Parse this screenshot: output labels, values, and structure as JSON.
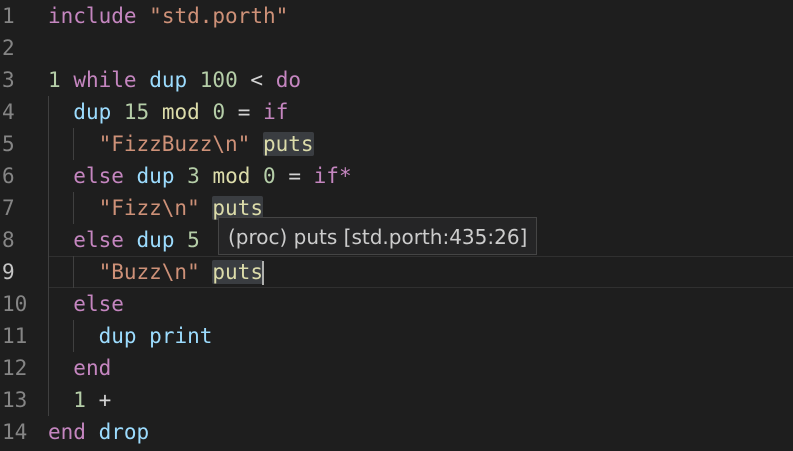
{
  "editor": {
    "lines": [
      {
        "no": "1",
        "tokens": [
          {
            "t": "include",
            "c": "kw"
          },
          {
            "t": " ",
            "c": ""
          },
          {
            "t": "\"std.porth\"",
            "c": "str"
          }
        ]
      },
      {
        "no": "2",
        "tokens": []
      },
      {
        "no": "3",
        "tokens": [
          {
            "t": "1",
            "c": "num"
          },
          {
            "t": " ",
            "c": ""
          },
          {
            "t": "while",
            "c": "kw"
          },
          {
            "t": " ",
            "c": ""
          },
          {
            "t": "dup",
            "c": "id"
          },
          {
            "t": " ",
            "c": ""
          },
          {
            "t": "100",
            "c": "num"
          },
          {
            "t": " ",
            "c": ""
          },
          {
            "t": "<",
            "c": "op"
          },
          {
            "t": " ",
            "c": ""
          },
          {
            "t": "do",
            "c": "kw"
          }
        ]
      },
      {
        "no": "4",
        "tokens": [
          {
            "t": "  ",
            "c": ""
          },
          {
            "t": "dup",
            "c": "id"
          },
          {
            "t": " ",
            "c": ""
          },
          {
            "t": "15",
            "c": "num"
          },
          {
            "t": " ",
            "c": ""
          },
          {
            "t": "mod",
            "c": "fn"
          },
          {
            "t": " ",
            "c": ""
          },
          {
            "t": "0",
            "c": "num"
          },
          {
            "t": " ",
            "c": ""
          },
          {
            "t": "=",
            "c": "op"
          },
          {
            "t": " ",
            "c": ""
          },
          {
            "t": "if",
            "c": "kw"
          }
        ]
      },
      {
        "no": "5",
        "tokens": [
          {
            "t": "    ",
            "c": ""
          },
          {
            "t": "\"FizzBuzz\\n\"",
            "c": "str"
          },
          {
            "t": " ",
            "c": ""
          },
          {
            "t": "puts",
            "c": "fn hl"
          }
        ]
      },
      {
        "no": "6",
        "tokens": [
          {
            "t": "  ",
            "c": ""
          },
          {
            "t": "else",
            "c": "kw"
          },
          {
            "t": " ",
            "c": ""
          },
          {
            "t": "dup",
            "c": "id"
          },
          {
            "t": " ",
            "c": ""
          },
          {
            "t": "3",
            "c": "num"
          },
          {
            "t": " ",
            "c": ""
          },
          {
            "t": "mod",
            "c": "fn"
          },
          {
            "t": " ",
            "c": ""
          },
          {
            "t": "0",
            "c": "num"
          },
          {
            "t": " ",
            "c": ""
          },
          {
            "t": "=",
            "c": "op"
          },
          {
            "t": " ",
            "c": ""
          },
          {
            "t": "if*",
            "c": "kw"
          }
        ]
      },
      {
        "no": "7",
        "tokens": [
          {
            "t": "    ",
            "c": ""
          },
          {
            "t": "\"Fizz\\n\"",
            "c": "str"
          },
          {
            "t": " ",
            "c": ""
          },
          {
            "t": "puts",
            "c": "fn hl"
          }
        ]
      },
      {
        "no": "8",
        "tokens": [
          {
            "t": "  ",
            "c": ""
          },
          {
            "t": "else",
            "c": "kw"
          },
          {
            "t": " ",
            "c": ""
          },
          {
            "t": "dup",
            "c": "id"
          },
          {
            "t": " ",
            "c": ""
          },
          {
            "t": "5",
            "c": "num"
          }
        ]
      },
      {
        "no": "9",
        "tokens": [
          {
            "t": "    ",
            "c": ""
          },
          {
            "t": "\"Buzz\\n\"",
            "c": "str"
          },
          {
            "t": " ",
            "c": ""
          },
          {
            "t": "puts",
            "c": "fn hl"
          }
        ],
        "current": true
      },
      {
        "no": "10",
        "tokens": [
          {
            "t": "  ",
            "c": ""
          },
          {
            "t": "else",
            "c": "kw"
          }
        ]
      },
      {
        "no": "11",
        "tokens": [
          {
            "t": "    ",
            "c": ""
          },
          {
            "t": "dup",
            "c": "id"
          },
          {
            "t": " ",
            "c": ""
          },
          {
            "t": "print",
            "c": "id"
          }
        ]
      },
      {
        "no": "12",
        "tokens": [
          {
            "t": "  ",
            "c": ""
          },
          {
            "t": "end",
            "c": "kw"
          }
        ]
      },
      {
        "no": "13",
        "tokens": [
          {
            "t": "  ",
            "c": ""
          },
          {
            "t": "1",
            "c": "num"
          },
          {
            "t": " ",
            "c": ""
          },
          {
            "t": "+",
            "c": "op"
          }
        ]
      },
      {
        "no": "14",
        "tokens": [
          {
            "t": "end",
            "c": "kw"
          },
          {
            "t": " ",
            "c": ""
          },
          {
            "t": "drop",
            "c": "id"
          }
        ]
      }
    ]
  },
  "hover": {
    "text": "(proc) puts [std.porth:435:26]"
  },
  "colors": {
    "background": "#1e1e1e",
    "keyword": "#c586c0",
    "string": "#ce9178",
    "number": "#b5cea8",
    "identifier": "#9cdcfe",
    "function": "#dcdcaa",
    "line_number": "#858585"
  }
}
